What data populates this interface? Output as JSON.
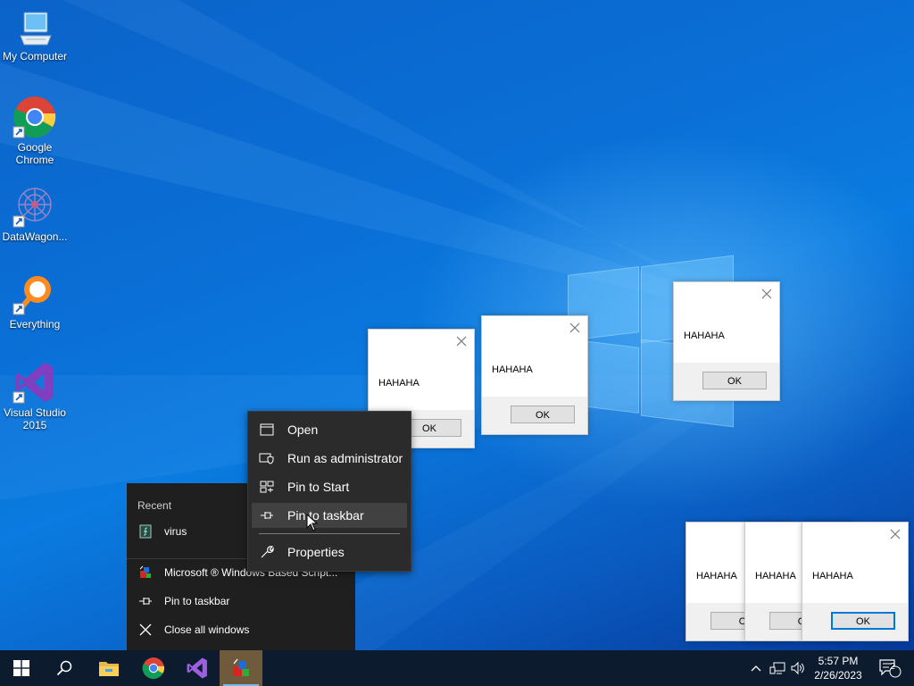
{
  "desktop_icons": [
    {
      "label": "My Computer",
      "icon": "computer-icon"
    },
    {
      "label": "Google Chrome",
      "icon": "chrome-icon"
    },
    {
      "label": "DataWagon...",
      "icon": "datawagon-icon"
    },
    {
      "label": "Everything",
      "icon": "everything-icon"
    },
    {
      "label": "Visual Studio 2015",
      "icon": "visual-studio-icon"
    }
  ],
  "message_boxes": [
    {
      "text": "HAHAHA",
      "button": "OK"
    },
    {
      "text": "HAHAHA",
      "button": "OK"
    },
    {
      "text": "HAHAHA",
      "button": "OK"
    },
    {
      "text": "HAHAHA",
      "button": "O"
    },
    {
      "text": "HAHAHA",
      "button": "O"
    },
    {
      "text": "HAHAHA",
      "button": "OK"
    }
  ],
  "jump_list": {
    "recent_header": "Recent",
    "recent_items": [
      {
        "label": "virus",
        "icon": "script-file-icon"
      }
    ],
    "tasks": [
      {
        "label": "Microsoft ® Windows Based Script...",
        "icon": "wscript-icon"
      },
      {
        "label": "Pin to taskbar",
        "icon": "pin-icon"
      },
      {
        "label": "Close all windows",
        "icon": "close-icon"
      }
    ]
  },
  "context_menu": {
    "items": [
      {
        "label": "Open",
        "icon": "window-icon"
      },
      {
        "label": "Run as administrator",
        "icon": "shield-icon"
      },
      {
        "label": "Pin to Start",
        "icon": "pin-start-icon"
      },
      {
        "label": "Pin to taskbar",
        "icon": "pin-icon",
        "hovered": true
      },
      {
        "label": "Properties",
        "icon": "wrench-icon"
      }
    ]
  },
  "taskbar": {
    "apps": [
      {
        "name": "Start",
        "icon": "windows-logo-icon"
      },
      {
        "name": "Search",
        "icon": "search-icon"
      },
      {
        "name": "File Explorer",
        "icon": "folder-icon"
      },
      {
        "name": "Google Chrome",
        "icon": "chrome-icon"
      },
      {
        "name": "Visual Studio",
        "icon": "visual-studio-icon"
      },
      {
        "name": "Windows Script Host",
        "icon": "wscript-icon",
        "highlighted": true
      }
    ],
    "tray": {
      "icons": [
        "chevron-up-icon",
        "network-icon",
        "volume-icon"
      ],
      "time": "5:57 PM",
      "date": "2/26/2023",
      "notification_count": "2"
    }
  },
  "colors": {
    "taskbar_bg": "#0d1b2e",
    "context_menu_bg": "#2b2b2b",
    "jump_list_bg": "#1f1f1f",
    "accent": "#0078d7"
  }
}
